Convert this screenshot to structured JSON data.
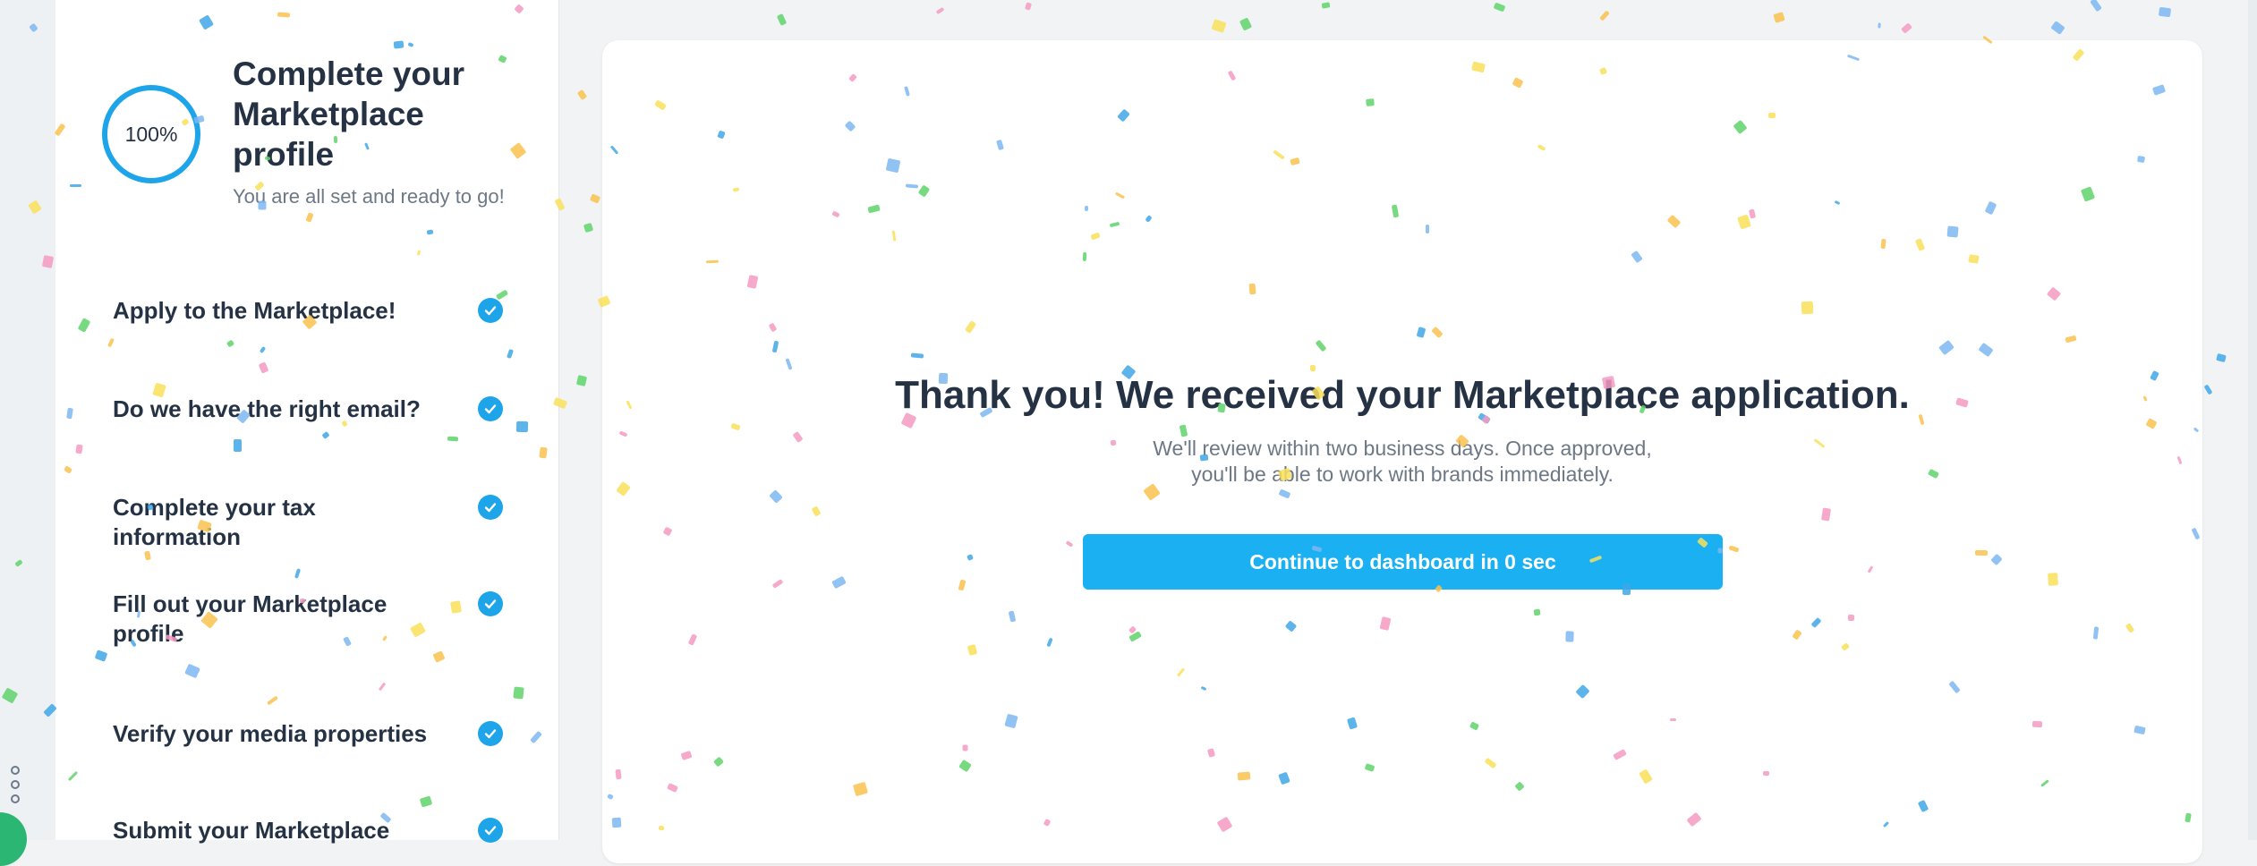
{
  "sidebar": {
    "progress_percent": 100,
    "progress_label": "100%",
    "title": "Complete your Marketplace profile",
    "subtitle": "You are all set and ready to go!",
    "steps": [
      {
        "label": "Apply to the Marketplace!",
        "done": true
      },
      {
        "label": "Do we have the right email?",
        "done": true
      },
      {
        "label": "Complete your tax information",
        "done": true
      },
      {
        "label": "Fill out your Marketplace profile",
        "done": true
      },
      {
        "label": "Verify your media properties",
        "done": true
      },
      {
        "label": "Submit your Marketplace",
        "done": true
      }
    ]
  },
  "main": {
    "headline": "Thank you! We received your Marketplace application.",
    "body_line1": "We'll review within two business days. Once approved,",
    "body_line2": "you'll be able to work with brands immediately.",
    "cta_label": "Continue to dashboard in 0 sec"
  },
  "icons": {
    "step_status": "check-circle-icon",
    "rail_menu": "more-options-icon"
  },
  "colors": {
    "accent": "#1ea4e9",
    "button": "#1ab0f2",
    "text_dark": "#253244",
    "text_muted": "#6d7885",
    "background": "#f1f3f5",
    "confetti": [
      "#f9e15b",
      "#5fd36b",
      "#7db7f2",
      "#f59ac2",
      "#f9c24e",
      "#3fa7e8"
    ]
  }
}
